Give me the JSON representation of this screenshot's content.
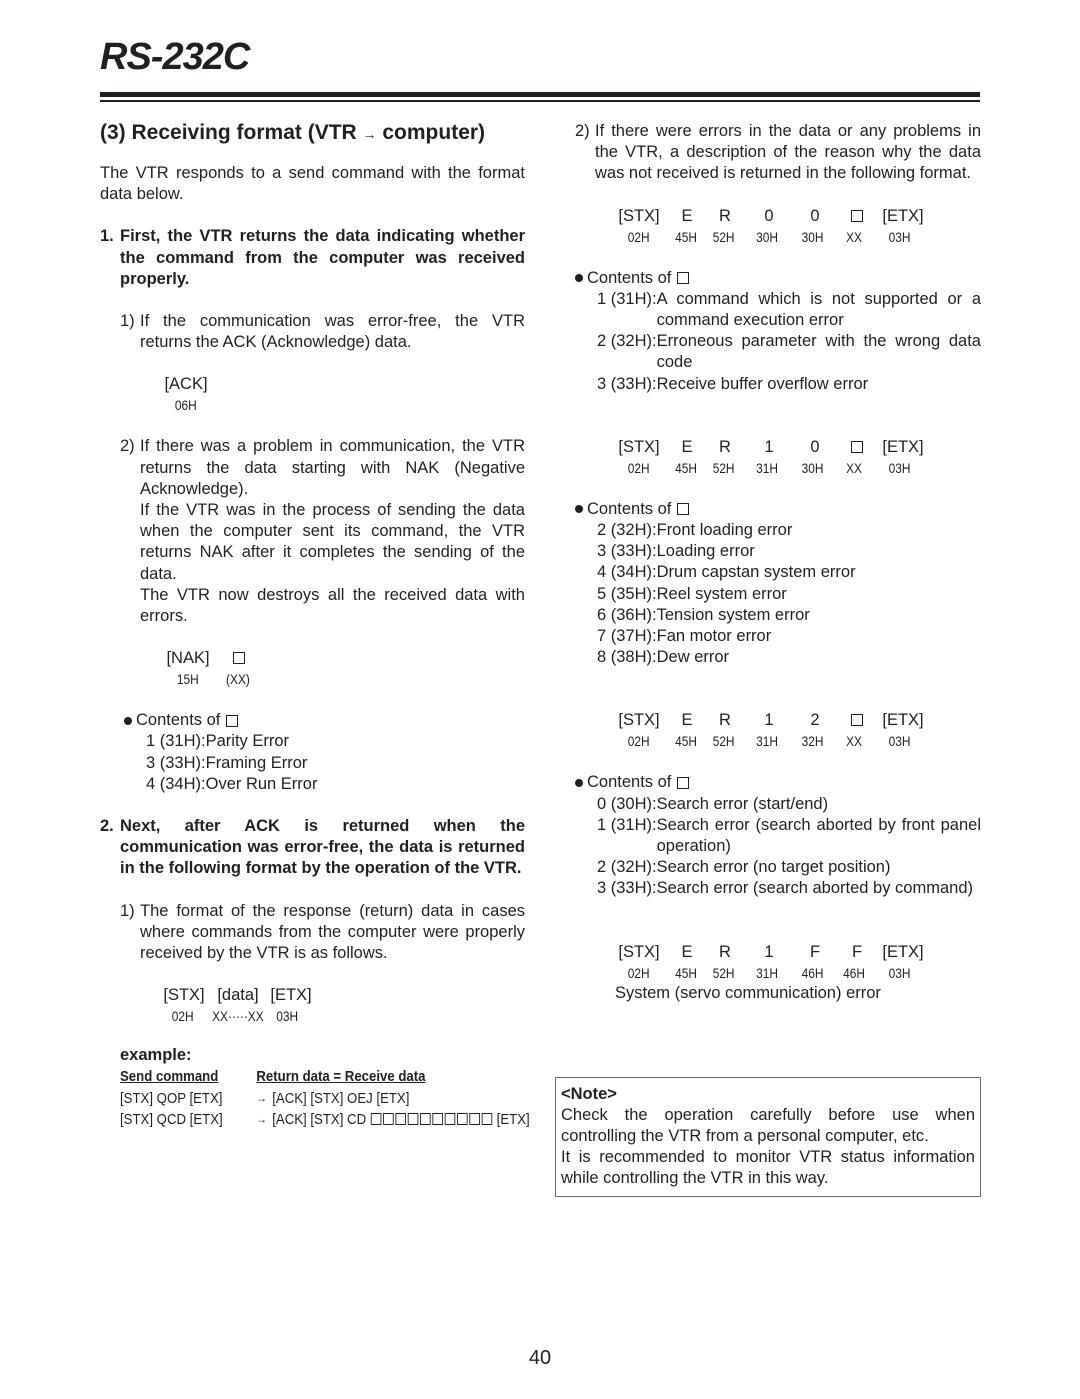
{
  "header": {
    "title": "RS-232C"
  },
  "section": {
    "heading_prefix": "(3) Receiving format (VTR ",
    "heading_arrow": "→",
    "heading_suffix": " computer)",
    "intro": "The VTR responds to a send command with the format data below."
  },
  "step1": {
    "num": "1.",
    "text": "First, the VTR returns the data indicating whether the command from the computer was received properly.",
    "sub1": {
      "num": "1)",
      "text": "If the communication was error-free, the VTR returns the ACK (Acknowledge) data.",
      "code": {
        "top": [
          "[ACK]"
        ],
        "bot": [
          "06H"
        ]
      }
    },
    "sub2": {
      "num": "2)",
      "p1": "If there was a problem in communication, the VTR returns the data starting with NAK (Negative Acknowledge).",
      "p2": "If the VTR was in the process of sending the data when the computer sent its command, the VTR returns NAK after it completes the sending of the data.",
      "p3": "The VTR now destroys all the received data with errors.",
      "code": {
        "top": [
          "[NAK]",
          "□"
        ],
        "bot": [
          "15H",
          "(XX)"
        ]
      },
      "contents_title": "Contents of",
      "entries": [
        {
          "code": "1 (31H): ",
          "desc": "Parity Error"
        },
        {
          "code": "3 (33H): ",
          "desc": "Framing Error"
        },
        {
          "code": "4 (34H): ",
          "desc": "Over Run Error"
        }
      ]
    }
  },
  "step2": {
    "num": "2.",
    "text": "Next, after ACK is returned when the communication was error-free, the data is returned in the following format by the operation of the VTR.",
    "sub1": {
      "num": "1)",
      "text": "The format of the response (return) data in cases where commands from the computer were properly received by the VTR is as follows.",
      "code": {
        "top": [
          "[STX]",
          "[data]",
          "[ETX]"
        ],
        "bot": [
          "02H",
          "XX·····XX",
          "03H"
        ]
      }
    },
    "example": {
      "label": "example:",
      "col_send": "Send command",
      "col_return": "Return data = Receive data",
      "rows": [
        {
          "send": "[STX] QOP [ETX]",
          "arrow": "→",
          "ret": "[ACK] [STX] OEJ [ETX]",
          "boxes": 0,
          "tail": ""
        },
        {
          "send": "[STX] QCD [ETX]",
          "arrow": "→",
          "ret": "[ACK] [STX] CD ",
          "boxes": 10,
          "tail": " [ETX]"
        }
      ]
    },
    "sub2": {
      "num": "2)",
      "text": "If there were errors in the data or any problems in the VTR, a description of the reason why the data was not received is returned in the following format.",
      "formats": [
        {
          "top": [
            "[STX]",
            "E",
            "R",
            "0",
            "0",
            "□",
            "[ETX]"
          ],
          "bot": [
            "02H",
            "45H",
            "52H",
            "30H",
            "30H",
            "XX",
            "03H"
          ],
          "contents_title": "Contents of",
          "entries": [
            {
              "code": "1 (31H): ",
              "desc": "A command which is not supported or a command execution error"
            },
            {
              "code": "2 (32H): ",
              "desc": "Erroneous parameter with the wrong data code"
            },
            {
              "code": "3 (33H): ",
              "desc": "Receive buffer overflow error"
            }
          ]
        },
        {
          "top": [
            "[STX]",
            "E",
            "R",
            "1",
            "0",
            "□",
            "[ETX]"
          ],
          "bot": [
            "02H",
            "45H",
            "52H",
            "31H",
            "30H",
            "XX",
            "03H"
          ],
          "contents_title": "Contents of",
          "entries": [
            {
              "code": "2 (32H): ",
              "desc": "Front loading error"
            },
            {
              "code": "3 (33H): ",
              "desc": "Loading error"
            },
            {
              "code": "4 (34H): ",
              "desc": "Drum capstan system error"
            },
            {
              "code": "5 (35H): ",
              "desc": "Reel system error"
            },
            {
              "code": "6 (36H): ",
              "desc": "Tension system error"
            },
            {
              "code": "7 (37H): ",
              "desc": "Fan motor error"
            },
            {
              "code": "8 (38H): ",
              "desc": "Dew error"
            }
          ]
        },
        {
          "top": [
            "[STX]",
            "E",
            "R",
            "1",
            "2",
            "□",
            "[ETX]"
          ],
          "bot": [
            "02H",
            "45H",
            "52H",
            "31H",
            "32H",
            "XX",
            "03H"
          ],
          "contents_title": "Contents of",
          "entries": [
            {
              "code": "0 (30H): ",
              "desc": "Search error (start/end)"
            },
            {
              "code": "1 (31H): ",
              "desc": "Search error (search aborted by front panel operation)"
            },
            {
              "code": "2 (32H): ",
              "desc": "Search error (no target position)"
            },
            {
              "code": "3 (33H): ",
              "desc": "Search error (search aborted by command)"
            }
          ]
        },
        {
          "top": [
            "[STX]",
            "E",
            "R",
            "1",
            "F",
            "F",
            "[ETX]"
          ],
          "bot": [
            "02H",
            "45H",
            "52H",
            "31H",
            "46H",
            "46H",
            "03H"
          ],
          "caption": "System (servo communication) error"
        }
      ]
    }
  },
  "note": {
    "title": "<Note>",
    "line1": "Check the operation carefully before use when controlling the VTR from a personal computer, etc.",
    "line2": "It is recommended to monitor VTR status information while controlling the VTR in this way."
  },
  "footer": {
    "page_number": "40"
  }
}
